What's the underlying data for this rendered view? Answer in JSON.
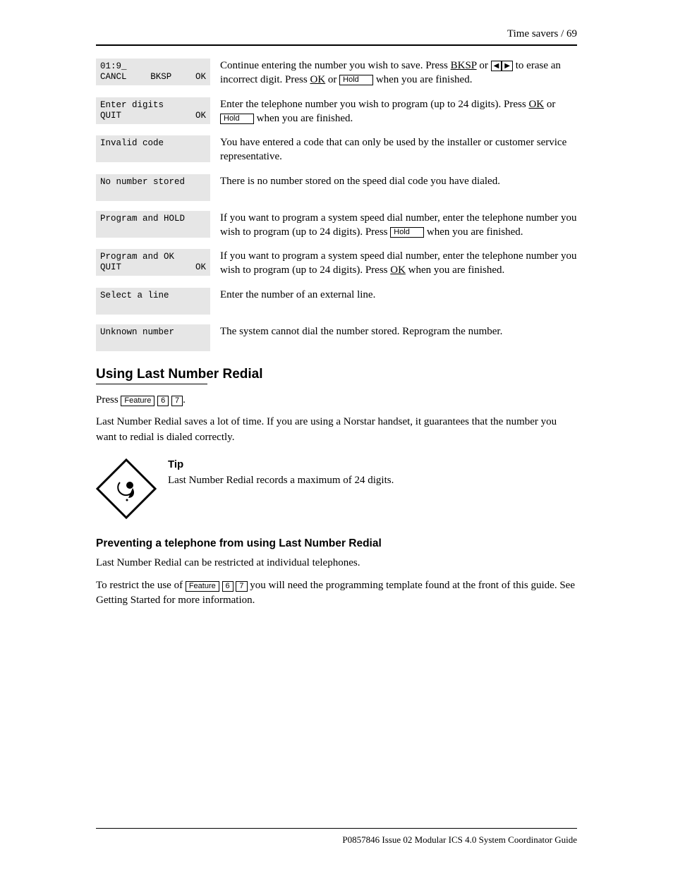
{
  "header": {
    "breadcrumb": "Time savers / 69"
  },
  "rows": [
    {
      "display": [
        {
          "left": "01:9_",
          "center": "",
          "right": ""
        },
        {
          "left": "CANCL",
          "center": "BKSP",
          "right": "OK"
        }
      ],
      "desc_html": "Continue entering the number you wish to save. Press {bksp_u} or {volL}{volR} to erase an incorrect digit. Press {ok_u} or {hold_k} when you are finished."
    },
    {
      "display": [
        {
          "left": "Enter digits",
          "center": "",
          "right": ""
        },
        {
          "left": "QUIT",
          "center": "",
          "right": "OK"
        }
      ],
      "desc_html": "Enter the telephone number you wish to program (up to 24 digits). Press {ok_u} or {hold_k} when you are finished."
    },
    {
      "display": [
        {
          "left": "Invalid code",
          "center": "",
          "right": ""
        }
      ],
      "desc_html": "You have entered a code that can only be used by the installer or customer service representative."
    },
    {
      "display": [
        {
          "left": "No number stored",
          "center": "",
          "right": ""
        }
      ],
      "desc_html": "There is no number stored on the speed dial code you have dialed."
    },
    {
      "display": [
        {
          "left": "Program and HOLD",
          "center": "",
          "right": ""
        }
      ],
      "desc_html": "If you want to program a system speed dial number, enter the telephone number you wish to program (up to 24 digits). Press {hold_k} when you are finished."
    },
    {
      "display": [
        {
          "left": "Program and OK",
          "center": "",
          "right": ""
        },
        {
          "left": "QUIT",
          "center": "",
          "right": "OK"
        }
      ],
      "desc_html": "If you want to program a system speed dial number, enter the telephone number you wish to program (up to 24 digits). Press {ok_u} when you are finished."
    },
    {
      "display": [
        {
          "left": "Select a line",
          "center": "",
          "right": ""
        }
      ],
      "desc_html": "Enter the number of an external line."
    },
    {
      "display": [
        {
          "left": "Unknown number",
          "center": "",
          "right": ""
        }
      ],
      "desc_html": "The system cannot dial the number stored. Reprogram the number."
    }
  ],
  "section": {
    "title": "Using Last Number Redial",
    "intro_before": "Press ",
    "feature_key": "Feature",
    "digits": [
      "6",
      "7"
    ],
    "intro_after": ".",
    "para": "Last Number Redial saves a lot of time. If you are using a Norstar handset, it guarantees that the number you want to redial is dialed correctly.",
    "tip_title": "Tip",
    "tip_text": "Last Number Redial records a maximum of 24 digits.",
    "sub_title": "Preventing a telephone from using Last Number Redial",
    "sub_para_1": "Last Number Redial can be restricted at individual telephones.",
    "sub_para_2_prefix": "To restrict the use of ",
    "sub_para_2_suffix": "you will need the programming template found at the front of this guide. See Getting Started for more information."
  },
  "footer": "P0857846 Issue 02    Modular ICS 4.0 System Coordinator Guide"
}
